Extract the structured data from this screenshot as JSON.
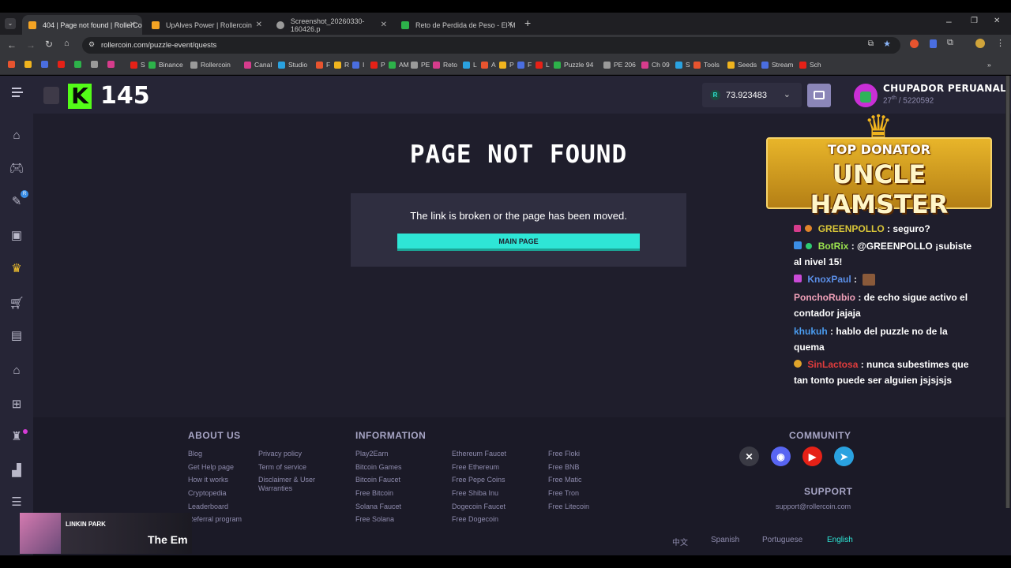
{
  "browser": {
    "tabs": [
      {
        "title": "404 | Page not found | RollerCo",
        "color": "#f4a424"
      },
      {
        "title": "UpAlves Power | Rollercoin",
        "color": "#f4a424"
      },
      {
        "title": "Screenshot_20260330-160426.p",
        "color": "#9a9a9a"
      },
      {
        "title": "Reto de Perdida de Peso - El M",
        "color": "#2db24a"
      }
    ],
    "url": "rollercoin.com/puzzle-event/quests",
    "bookmarks": [
      "S",
      "Binance",
      "Rollercoin",
      "Canal",
      "Studio",
      "F",
      "R",
      "I",
      "P",
      "AM",
      "PE",
      "Reto",
      "L",
      "A",
      "P",
      "F",
      "L",
      "Puzzle 94",
      "PE 206",
      "Ch 09",
      "S",
      "Tools",
      "Seeds",
      "Stream",
      "Sch"
    ]
  },
  "overlay": {
    "level": "145",
    "donator_top": "TOP DONATOR",
    "donator_name": "UNCLE HAMSTER",
    "music_artist": "LINKIN PARK",
    "music_title": "The Em"
  },
  "header": {
    "balance": "73.923483",
    "username": "CHUPADOR PERUANAL",
    "rank": "27",
    "rank_sup": "th",
    "rank_total": "/ 5220592"
  },
  "main": {
    "title": "PAGE NOT FOUND",
    "message": "The link is broken or the page has been moved.",
    "button": "MAIN PAGE"
  },
  "chat": [
    {
      "user": "GREENPOLLO",
      "text": ": seguro?",
      "color": "#d9c638"
    },
    {
      "user": "BotRix",
      "text": ": @GREENPOLLO ¡subiste al nivel 15!",
      "color": "#9be34e"
    },
    {
      "user": "KnoxPaul",
      "text": ":",
      "color": "#5b8fe8"
    },
    {
      "user": "PonchoRubio",
      "text": ": de echo sigue activo el contador jajaja",
      "color": "#f0a0b8"
    },
    {
      "user": "khukuh",
      "text": ": hablo del puzzle no de la quema",
      "color": "#4a9cf0"
    },
    {
      "user": "SinLactosa",
      "text": ": nunca subestimes que tan tonto puede ser alguien jsjsjsjs",
      "color": "#e03c3c"
    }
  ],
  "footer": {
    "about_title": "ABOUT US",
    "about_col1": [
      "Blog",
      "Get Help page",
      "How it works",
      "Cryptopedia",
      "Leaderboard",
      "Referral program"
    ],
    "about_col2": [
      "Privacy policy",
      "Term of service",
      "Disclaimer & User Warranties"
    ],
    "info_title": "INFORMATION",
    "info_col1": [
      "Play2Earn",
      "Bitcoin Games",
      "Bitcoin Faucet",
      "Free Bitcoin",
      "Solana Faucet",
      "Free Solana"
    ],
    "info_col2": [
      "Ethereum Faucet",
      "Free Ethereum",
      "Free Pepe Coins",
      "Free Shiba Inu",
      "Dogecoin Faucet",
      "Free Dogecoin"
    ],
    "info_col3": [
      "Free Floki",
      "Free BNB",
      "Free Matic",
      "Free Tron",
      "Free Litecoin"
    ],
    "community_title": "COMMUNITY",
    "support_title": "SUPPORT",
    "support_email": "support@rollercoin.com",
    "languages": [
      "中文",
      "Spanish",
      "Portuguese",
      "English"
    ],
    "active_language": "English"
  },
  "colors": {
    "accent": "#2ee6d6",
    "bg": "#1f1e2c",
    "panel": "#2f2e40"
  }
}
